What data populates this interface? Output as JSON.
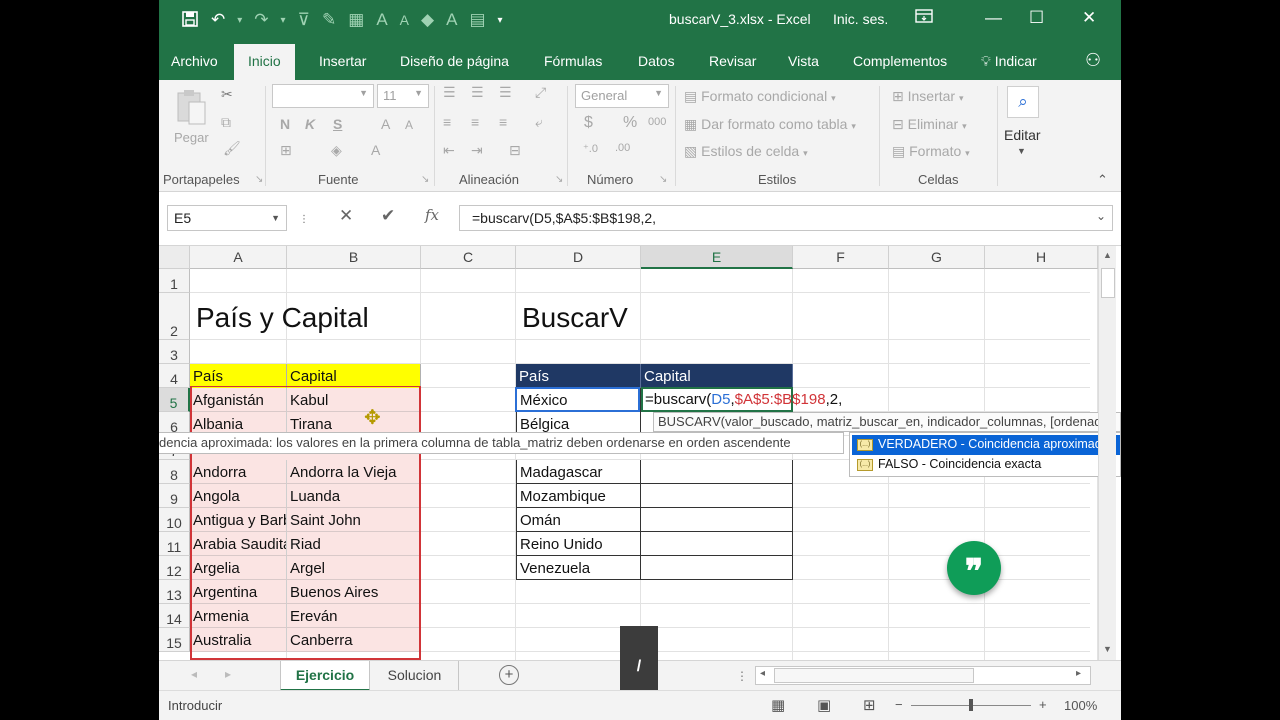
{
  "titlebar": {
    "document_title": "buscarV_3.xlsx - Excel",
    "signin_label": "Inic. ses.",
    "qat_icons": [
      "save-icon",
      "undo-icon",
      "redo-icon",
      "filter-icon",
      "paint-icon",
      "border-icon",
      "font-size-increase-icon",
      "font-size-decrease-icon",
      "fill-color-icon",
      "font-color-icon",
      "customize-icon"
    ]
  },
  "tabs": [
    "Archivo",
    "Inicio",
    "Insertar",
    "Diseño de página",
    "Fórmulas",
    "Datos",
    "Revisar",
    "Vista",
    "Complementos"
  ],
  "tell_me": "Indicar",
  "ribbon": {
    "clipboard": {
      "paste_label": "Pegar",
      "group": "Portapapeles"
    },
    "font": {
      "font_size": "11",
      "bold": "N",
      "italic": "K",
      "underline": "S",
      "group": "Fuente"
    },
    "alignment": {
      "group": "Alineación"
    },
    "number": {
      "format": "General",
      "currency": "$",
      "percent": "%",
      "thousands": "000",
      "group": "Número"
    },
    "styles": {
      "conditional": "Formato condicional",
      "as_table": "Dar formato como tabla",
      "cell_styles": "Estilos de celda",
      "group": "Estilos"
    },
    "cells": {
      "insert": "Insertar",
      "delete": "Eliminar",
      "format": "Formato",
      "group": "Celdas"
    },
    "editing": {
      "label": "Editar"
    }
  },
  "formula_bar": {
    "name_box": "E5",
    "cancel_glyph": "✕",
    "enter_glyph": "✔",
    "fx_glyph": "fx",
    "formula": "=buscarv(D5,$A$5:$B$198,2,"
  },
  "grid": {
    "columns": [
      "A",
      "B",
      "C",
      "D",
      "E",
      "F",
      "G",
      "H"
    ],
    "rows": [
      "1",
      "2",
      "3",
      "4",
      "5",
      "6",
      "7",
      "8",
      "9",
      "10",
      "11",
      "12",
      "13",
      "14",
      "15"
    ],
    "title_left": "País y Capital",
    "title_right": "BuscarV",
    "left_table": {
      "headers": [
        "País",
        "Capital"
      ],
      "rows": [
        [
          "Afganistán",
          "Kabul"
        ],
        [
          "Albania",
          "Tirana"
        ],
        [
          "Andorra",
          "Andorra la Vieja"
        ],
        [
          "Angola",
          "Luanda"
        ],
        [
          "Antigua y Barbuda",
          "Saint John"
        ],
        [
          "Arabia Saudita",
          "Riad"
        ],
        [
          "Argelia",
          "Argel"
        ],
        [
          "Argentina",
          "Buenos Aires"
        ],
        [
          "Armenia",
          "Ereván"
        ],
        [
          "Australia",
          "Canberra"
        ]
      ]
    },
    "right_table": {
      "headers": [
        "País",
        "Capital"
      ],
      "countries": [
        "México",
        "Bélgica",
        "Madagascar",
        "Mozambique",
        "Omán",
        "Reino Unido",
        "Venezuela"
      ]
    },
    "edit_cell": {
      "prefix": "=buscarv(",
      "arg1": "D5",
      "comma1": ",",
      "arg2": "$A$5:$B$198",
      "suffix": ",2,"
    }
  },
  "tooltips": {
    "syntax": "BUSCARV(valor_buscado, matriz_buscar_en, indicador_columnas, [ordenado])",
    "description": "dencia aproximada: los valores en la primera columna de tabla_matriz deben ordenarse en orden ascendente",
    "options": [
      {
        "label": "VERDADERO - Coincidencia aproximada",
        "selected": true
      },
      {
        "label": "FALSO - Coincidencia exacta",
        "selected": false
      }
    ]
  },
  "sheets": [
    {
      "label": "Ejercicio",
      "active": true
    },
    {
      "label": "Solucion",
      "active": false
    }
  ],
  "status": {
    "mode": "Introducir",
    "zoom": "100%"
  },
  "colors": {
    "excel_green": "#217346",
    "yellow_header": "#ffff00",
    "navy_header": "#1f3864",
    "pink_fill": "#fbe4e3",
    "ref_blue": "#2b6fd6",
    "ref_red": "#d13438",
    "fab_green": "#0f9d58"
  }
}
